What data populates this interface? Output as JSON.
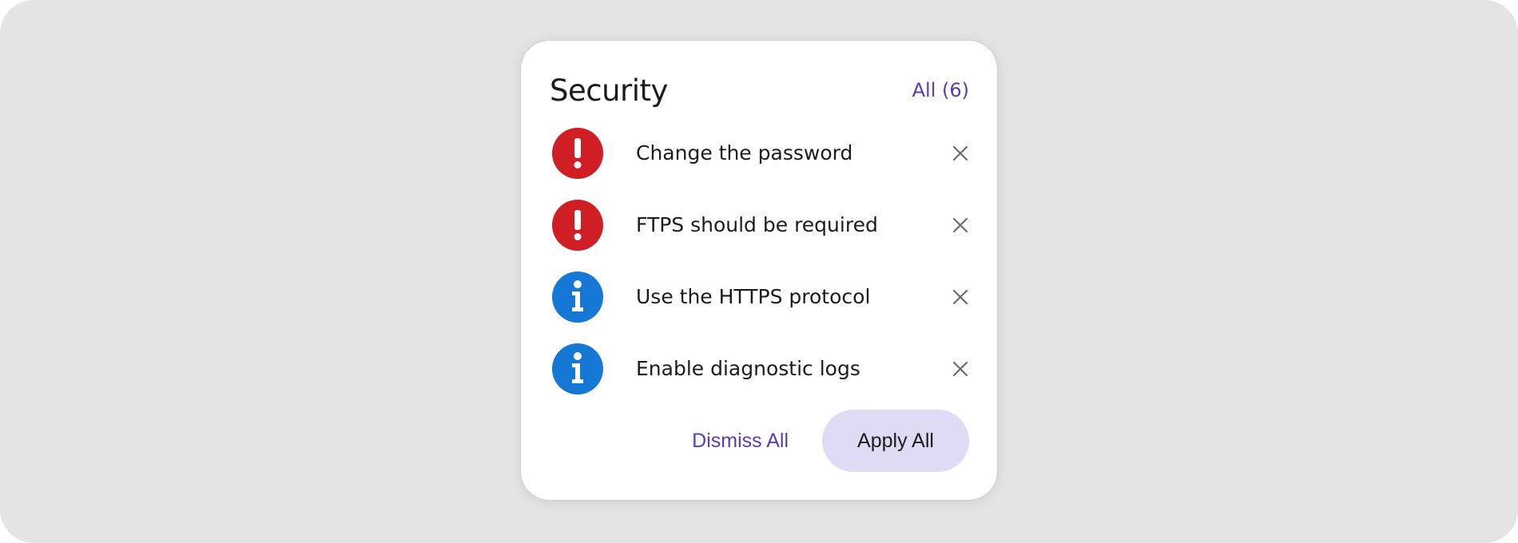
{
  "panel": {
    "title": "Security",
    "all_link": "All (6)"
  },
  "items": [
    {
      "label": "Change the password",
      "severity": "error",
      "icon": "exclamation-icon"
    },
    {
      "label": "FTPS should be required",
      "severity": "error",
      "icon": "exclamation-icon"
    },
    {
      "label": "Use the HTTPS protocol",
      "severity": "info",
      "icon": "info-icon"
    },
    {
      "label": "Enable diagnostic logs",
      "severity": "info",
      "icon": "info-icon"
    }
  ],
  "footer": {
    "dismiss_label": "Dismiss All",
    "apply_label": "Apply All"
  },
  "colors": {
    "error": "#d01f24",
    "info": "#1578d4",
    "accent": "#5a3db3",
    "apply_bg": "#e0dbf5"
  }
}
